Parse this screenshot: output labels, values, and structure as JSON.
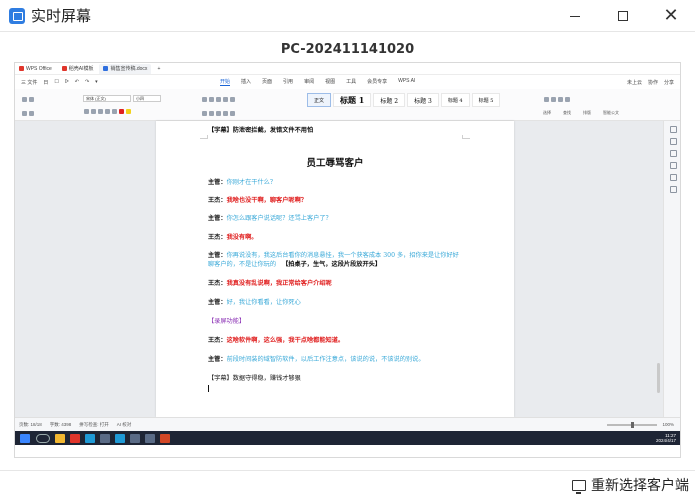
{
  "window": {
    "title": "实时屏幕",
    "icon": "screen-share-icon",
    "controls": [
      "minimize",
      "maximize",
      "close"
    ]
  },
  "screen_label": "PC-202411141020",
  "wps": {
    "tabs": [
      {
        "label": "WPS Office",
        "color": "#e0352b"
      },
      {
        "label": "稻壳AI模板",
        "color": "#e0352b"
      },
      {
        "label": "销售宣传稿.docx",
        "color": "#2f6fde"
      }
    ],
    "tab_add": "+",
    "menu_left": [
      "三 文件",
      "日",
      "☐",
      "ᐅ",
      "↶",
      "↷",
      "▾"
    ],
    "menu_center": [
      "开始",
      "插入",
      "页面",
      "引用",
      "审阅",
      "视图",
      "工具",
      "会员专享",
      "WPS AI"
    ],
    "menu_active": "开始",
    "menu_right": [
      "未上云",
      "协作",
      "分享"
    ],
    "ribbon": {
      "font_name": "宋体 (正文)",
      "font_size": "小四",
      "group_labels": [
        "格式刷",
        "粘贴",
        "样式",
        "查找替换",
        "排版",
        "智能公文"
      ],
      "styles": [
        {
          "label": "正文",
          "kind": "small",
          "selected": true
        },
        {
          "label": "标题 1",
          "kind": "big"
        },
        {
          "label": "标题 2",
          "kind": "mid"
        },
        {
          "label": "标题 3",
          "kind": "mid"
        },
        {
          "label": "标题 4",
          "kind": "small"
        },
        {
          "label": "标题 5",
          "kind": "small"
        }
      ],
      "right_buttons": [
        "选择",
        "查找",
        "排版",
        "智能公文"
      ]
    },
    "document": {
      "subtitle": "【字幕】防泄密拦截，发错文件不用怕",
      "title": "员工辱骂客户",
      "lines": [
        {
          "speaker": "主管：",
          "text": "你刚才在干什么？",
          "color": "blue"
        },
        {
          "speaker": "王杰：",
          "text": "我啥也没干啊，聊客户呢啊？",
          "color": "red"
        },
        {
          "speaker": "主管：",
          "text": "你怎么跟客户说话呢？还骂上客户了？",
          "color": "blue"
        },
        {
          "speaker": "王杰：",
          "text": "我没有啊。",
          "color": "red"
        },
        {
          "speaker": "主管：",
          "text": "你再说没有，我这后台看你的消息悬挂，我一个获客成本 300 多，招你来是让你好好聊客户的，不是让你玩的",
          "color": "blue",
          "tail": "【拍桌子，生气，这段片段放开头】"
        },
        {
          "speaker": "王杰：",
          "text": "我真没有乱说啊，我正常给客户介绍呢",
          "color": "red"
        },
        {
          "speaker": "主管：",
          "text": "好，我让你看看，让你死心",
          "color": "blue"
        },
        {
          "speaker": "",
          "text": "【录屏功能】",
          "color": "purple"
        },
        {
          "speaker": "王杰：",
          "text": "这啥软件啊，这么强，我干点啥都能知道。",
          "color": "red"
        },
        {
          "speaker": "主管：",
          "text": "前段时间装的域智防软件，以后工作注意点，该说的说，不该说的别说。",
          "color": "blue"
        },
        {
          "speaker": "",
          "text": "【字幕】数据守得稳，赚钱才够狠",
          "color": "black"
        }
      ]
    },
    "status": {
      "left": [
        "页数: 18/18",
        "字数: 4398",
        "拼写检查: 打开",
        "AI 校对"
      ],
      "zoom": "100%"
    },
    "taskbar_clock": {
      "time": "11:27",
      "date": "2024/4/17"
    },
    "taskbar_apps": [
      "windows-start-icon",
      "search-icon",
      "explorer-icon",
      "wps-icon",
      "edge-icon",
      "app-icon",
      "edge-icon",
      "app-icon",
      "app-icon",
      "powerpoint-icon"
    ]
  },
  "reselect_button": "重新选择客户端",
  "colors": {
    "blue": "#3aa9d8",
    "red": "#e02020",
    "purple": "#8a2fb4",
    "black": "#111111",
    "accent": "#1a64d6"
  }
}
